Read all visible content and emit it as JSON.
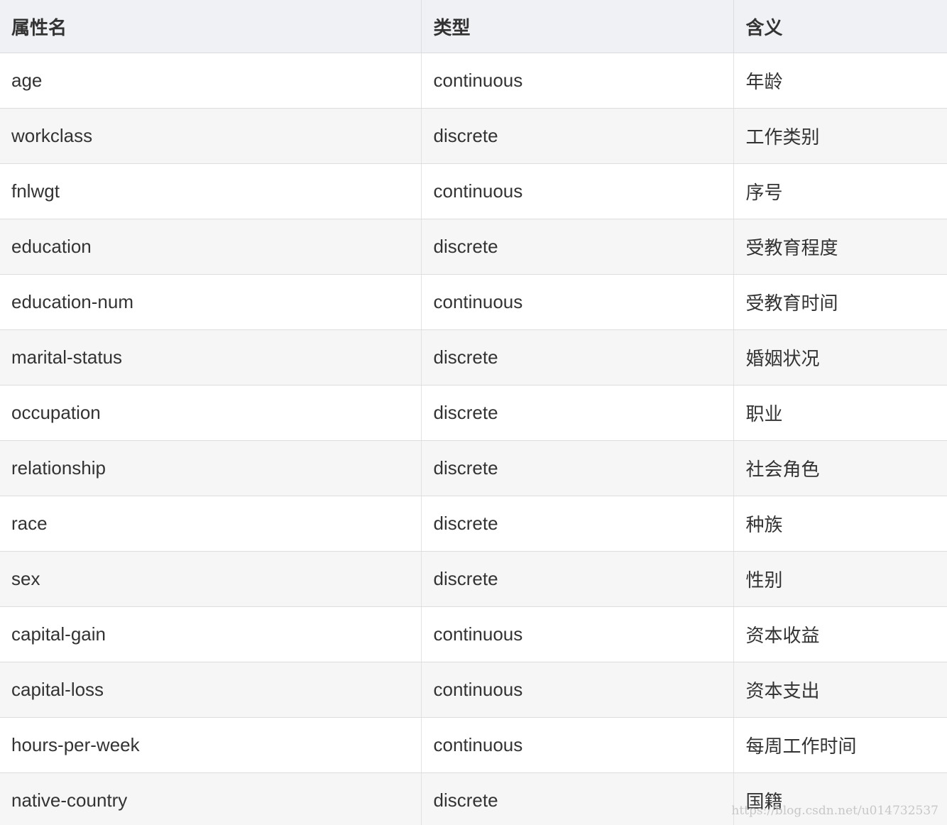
{
  "table": {
    "columns": [
      "属性名",
      "类型",
      "含义"
    ],
    "rows": [
      [
        "age",
        "continuous",
        "年龄"
      ],
      [
        "workclass",
        "discrete",
        "工作类别"
      ],
      [
        "fnlwgt",
        "continuous",
        "序号"
      ],
      [
        "education",
        "discrete",
        "受教育程度"
      ],
      [
        "education-num",
        "continuous",
        "受教育时间"
      ],
      [
        "marital-status",
        "discrete",
        "婚姻状况"
      ],
      [
        "occupation",
        "discrete",
        "职业"
      ],
      [
        "relationship",
        "discrete",
        "社会角色"
      ],
      [
        "race",
        "discrete",
        "种族"
      ],
      [
        "sex",
        "discrete",
        "性别"
      ],
      [
        "capital-gain",
        "continuous",
        "资本收益"
      ],
      [
        "capital-loss",
        "continuous",
        "资本支出"
      ],
      [
        "hours-per-week",
        "continuous",
        "每周工作时间"
      ],
      [
        "native-country",
        "discrete",
        "国籍"
      ]
    ]
  },
  "watermark": "https://blog.csdn.net/u014732537",
  "colors": {
    "header_background": "#eff1f4",
    "row_alt_background": "#f6f6f6",
    "border": "#dddddd",
    "text": "#333333"
  }
}
